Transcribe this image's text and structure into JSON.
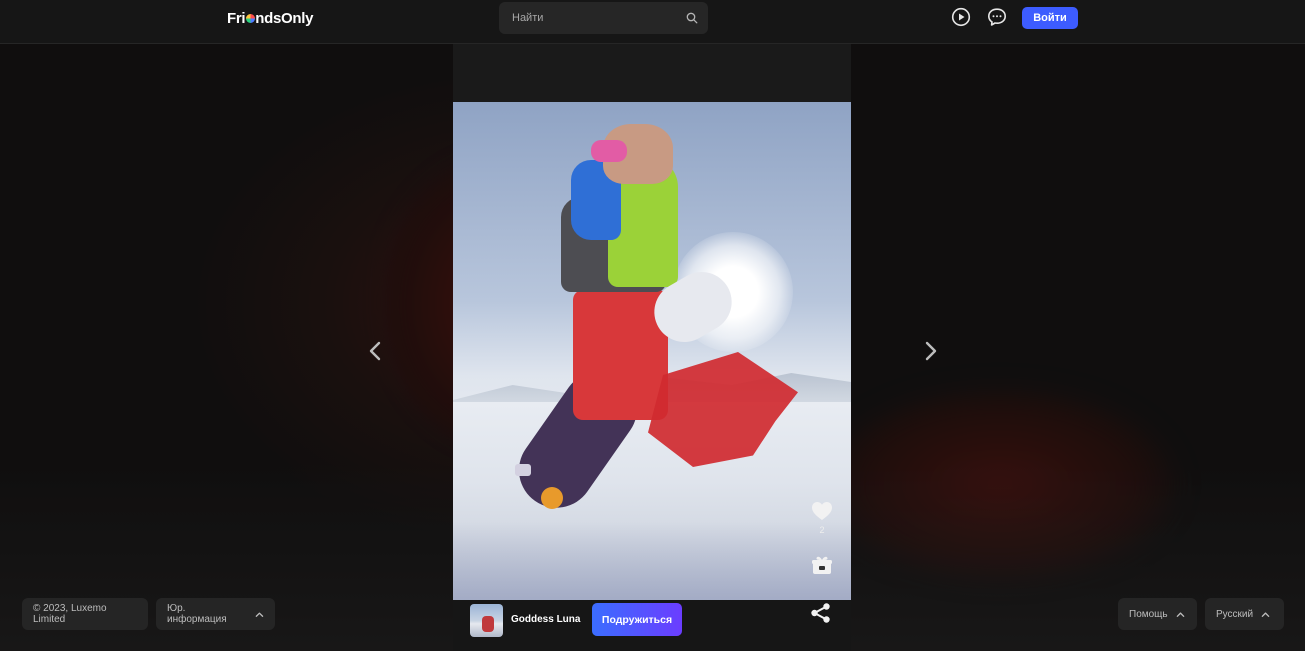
{
  "header": {
    "logo_prefix": "Fri",
    "logo_suffix": "ndsOnly",
    "search_placeholder": "Найти",
    "login_label": "Войти"
  },
  "post": {
    "likes": "2",
    "username": "Goddess Luna",
    "follow_label": "Подружиться"
  },
  "footer": {
    "copyright": "© 2023, Luxemo Limited",
    "legal": "Юр. информация",
    "help": "Помощь",
    "language": "Русский"
  },
  "colors": {
    "accent": "#3d5cff",
    "follow_gradient_start": "#3b6dff",
    "follow_gradient_end": "#6b3dff",
    "header_bg": "#161616"
  },
  "icons": [
    "search-icon",
    "play-icon",
    "chat-icon",
    "heart-icon",
    "gift-icon",
    "muted-icon",
    "share-icon",
    "chevron-left-icon",
    "chevron-right-icon",
    "chevron-up-icon"
  ]
}
